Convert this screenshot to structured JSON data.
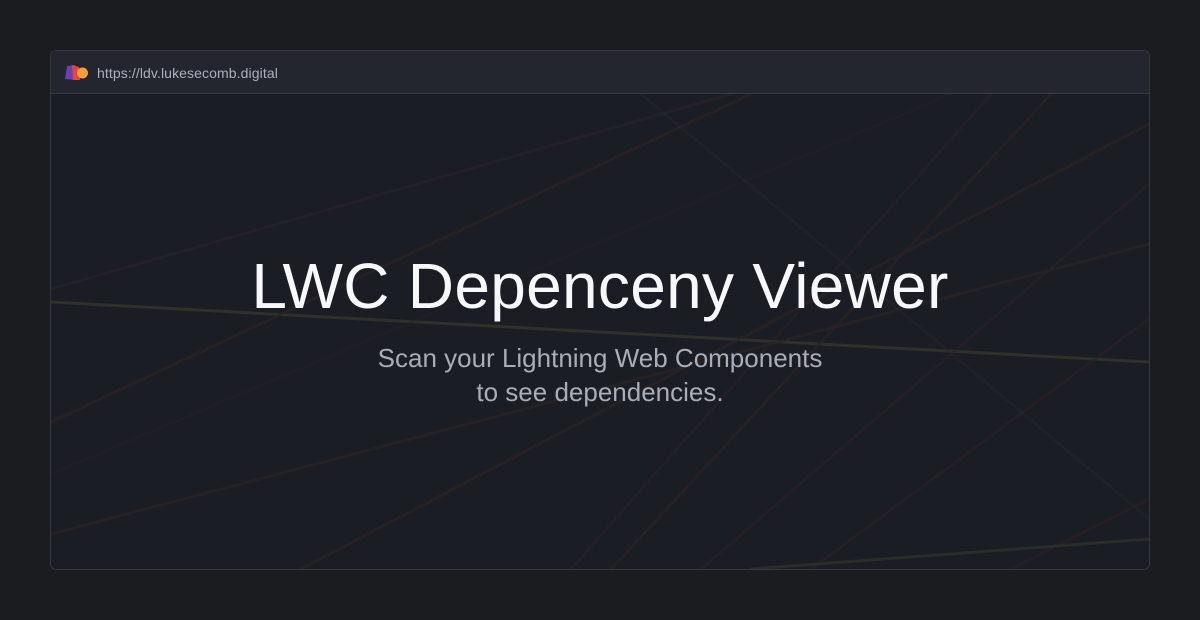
{
  "browser": {
    "url": "https://ldv.lukesecomb.digital",
    "logo_icon": "app-logo-icon"
  },
  "hero": {
    "title": "LWC Depenceny Viewer",
    "subtitle_line1": "Scan your Lightning Web Components",
    "subtitle_line2": "to see dependencies."
  },
  "colors": {
    "page_background": "#1b1c20",
    "window_background": "#1b1d24",
    "address_bar": "#23262f",
    "title_text": "#f7f8fa",
    "subtitle_text": "#a8adb8",
    "logo_purple": "#6d3fb6",
    "logo_red": "#e3463f",
    "logo_orange": "#f0a13a"
  }
}
